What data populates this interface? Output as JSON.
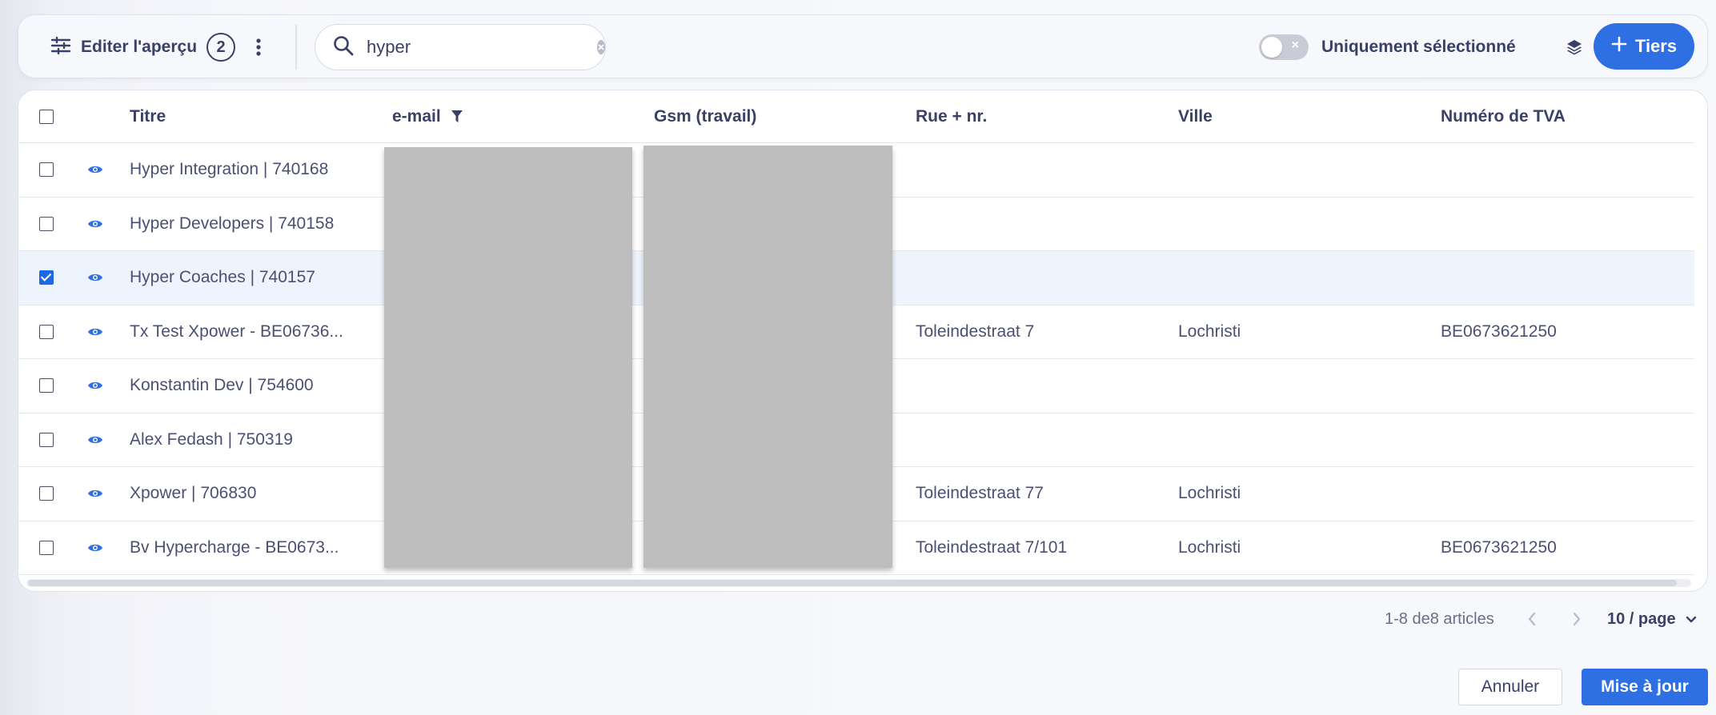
{
  "colors": {
    "accent": "#2f6fe4",
    "checkbox_checked": "#1a6ae5",
    "text_primary": "#3b4066",
    "selected_row_bg": "#eef4fd",
    "redaction": "#bdbdbd"
  },
  "toolbar": {
    "edit_preview_label": "Editer l'aperçu",
    "edit_preview_count": "2",
    "search": {
      "value": "hyper",
      "placeholder": ""
    },
    "toggle_label": "Uniquement sélectionné",
    "toggle_state": "off",
    "add_button_label": "Tiers",
    "icons": [
      "sliders-icon",
      "kebab-menu-icon",
      "search-icon",
      "clear-icon",
      "layers-icon",
      "plus-icon"
    ]
  },
  "table": {
    "columns": [
      "Titre",
      "e-mail",
      "Gsm (travail)",
      "Rue + nr.",
      "Ville",
      "Numéro de TVA"
    ],
    "filtered_column": "e-mail",
    "rows": [
      {
        "title": "Hyper Integration | 740168",
        "street": "",
        "city": "",
        "vat": "",
        "selected": false
      },
      {
        "title": "Hyper Developers | 740158",
        "street": "",
        "city": "",
        "vat": "",
        "selected": false
      },
      {
        "title": "Hyper Coaches | 740157",
        "street": "",
        "city": "",
        "vat": "",
        "selected": true
      },
      {
        "title": "Tx Test Xpower - BE06736...",
        "street": "Toleindestraat 7",
        "city": "Lochristi",
        "vat": "BE0673621250",
        "selected": false
      },
      {
        "title": "Konstantin Dev | 754600",
        "street": "",
        "city": "",
        "vat": "",
        "selected": false
      },
      {
        "title": "Alex Fedash | 750319",
        "street": "",
        "city": "",
        "vat": "",
        "selected": false
      },
      {
        "title": "Xpower | 706830",
        "street": "Toleindestraat 77",
        "city": "Lochristi",
        "vat": "",
        "selected": false
      },
      {
        "title": "Bv Hypercharge - BE0673...",
        "street": "Toleindestraat 7/101",
        "city": "Lochristi",
        "vat": "BE0673621250",
        "selected": false
      }
    ]
  },
  "pagination": {
    "range_text": "1-8 de8 articles",
    "page_size": "10 / page"
  },
  "footer": {
    "cancel_label": "Annuler",
    "update_label": "Mise à jour"
  }
}
